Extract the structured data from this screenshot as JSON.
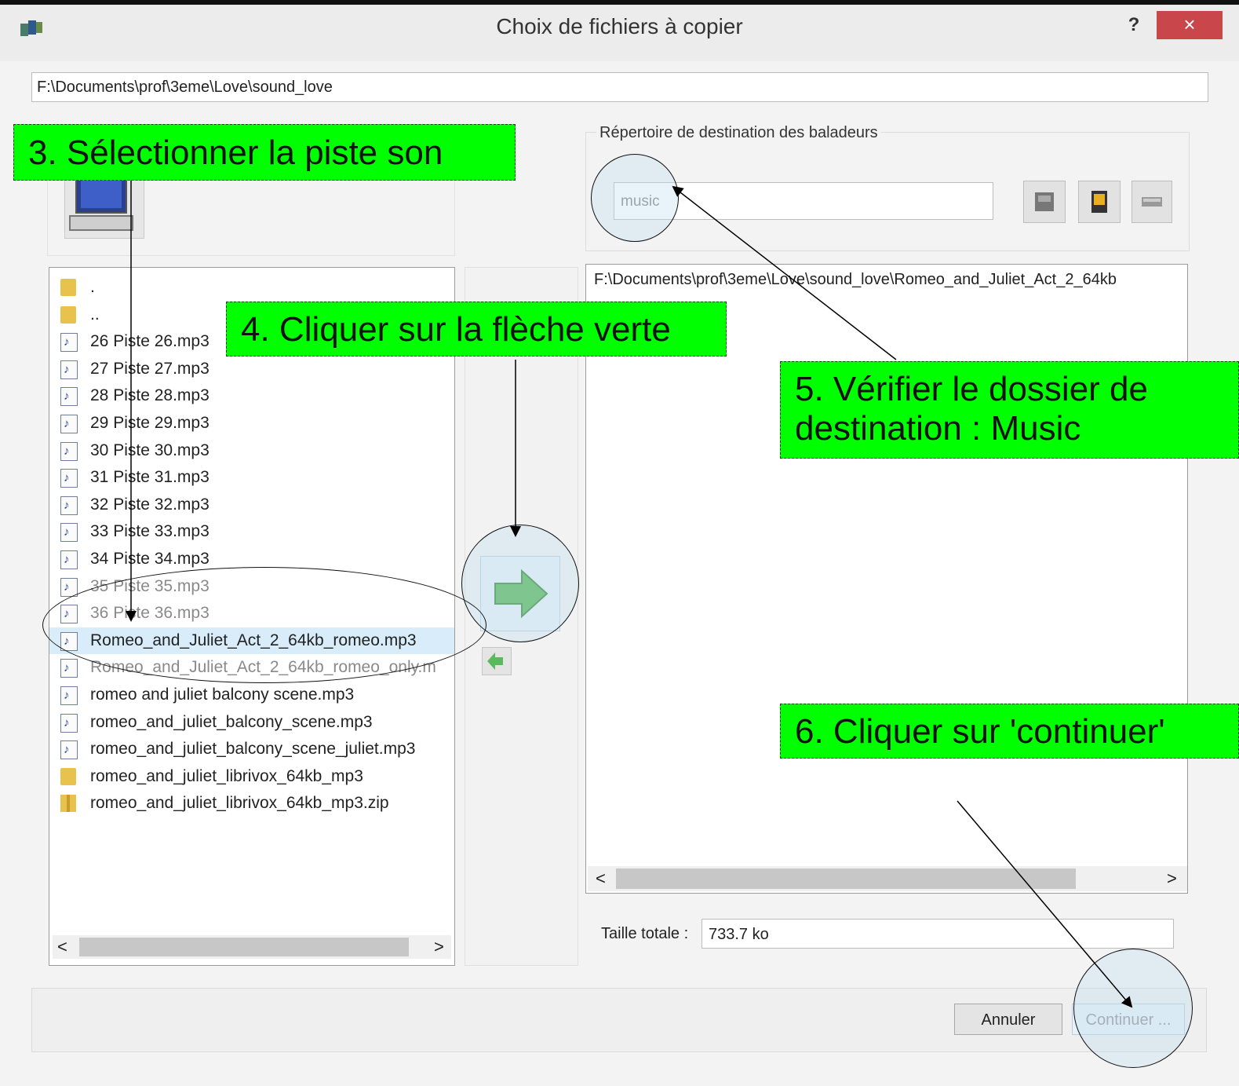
{
  "window": {
    "title": "Choix de fichiers à copier",
    "help_label": "?",
    "close_label": "×"
  },
  "source_path": "F:\\Documents\\prof\\3eme\\Love\\sound_love",
  "file_list": {
    "items": [
      {
        "name": ".",
        "icon": "folder-icon"
      },
      {
        "name": "..",
        "icon": "folder-icon"
      },
      {
        "name": "26 Piste 26.mp3",
        "icon": "audio-file-icon"
      },
      {
        "name": "27 Piste 27.mp3",
        "icon": "audio-file-icon"
      },
      {
        "name": "28 Piste 28.mp3",
        "icon": "audio-file-icon"
      },
      {
        "name": "29 Piste 29.mp3",
        "icon": "audio-file-icon"
      },
      {
        "name": "30 Piste 30.mp3",
        "icon": "audio-file-icon"
      },
      {
        "name": "31 Piste 31.mp3",
        "icon": "audio-file-icon"
      },
      {
        "name": "32 Piste 32.mp3",
        "icon": "audio-file-icon"
      },
      {
        "name": "33 Piste 33.mp3",
        "icon": "audio-file-icon"
      },
      {
        "name": "34 Piste 34.mp3",
        "icon": "audio-file-icon"
      },
      {
        "name": "35 Piste 35.mp3",
        "icon": "audio-file-icon"
      },
      {
        "name": "36 Piste 36.mp3",
        "icon": "audio-file-icon"
      },
      {
        "name": "Romeo_and_Juliet_Act_2_64kb_romeo.mp3",
        "icon": "audio-file-icon",
        "selected": true
      },
      {
        "name": "Romeo_and_Juliet_Act_2_64kb_romeo_only.m",
        "icon": "audio-file-icon"
      },
      {
        "name": "romeo and juliet balcony scene.mp3",
        "icon": "audio-file-icon"
      },
      {
        "name": "romeo_and_juliet_balcony_scene.mp3",
        "icon": "audio-file-icon"
      },
      {
        "name": "romeo_and_juliet_balcony_scene_juliet.mp3",
        "icon": "audio-file-icon"
      },
      {
        "name": "romeo_and_juliet_librivox_64kb_mp3",
        "icon": "folder-icon"
      },
      {
        "name": "romeo_and_juliet_librivox_64kb_mp3.zip",
        "icon": "zip-folder-icon"
      }
    ]
  },
  "destination": {
    "legend": "Répertoire de destination des baladeurs",
    "folder_value": "music",
    "selected_file": "F:\\Documents\\prof\\3eme\\Love\\sound_love\\Romeo_and_Juliet_Act_2_64kb"
  },
  "total": {
    "label": "Taille totale :",
    "value": "733.7 ko"
  },
  "buttons": {
    "cancel": "Annuler",
    "continue": "Continuer ..."
  },
  "scroll": {
    "left_arrow": "<",
    "right_arrow": ">"
  },
  "annotations": {
    "step3": "3. Sélectionner la piste son",
    "step4": "4. Cliquer sur la flèche verte",
    "step5_line1": "5. Vérifier le dossier de",
    "step5_line2": "destination : Music",
    "step6": "6. Cliquer sur 'continuer'"
  },
  "colors": {
    "callout": "#00ff00",
    "close_button": "#c9464a",
    "selection": "#d8ecfa",
    "arrow_green": "#5cb85c"
  }
}
